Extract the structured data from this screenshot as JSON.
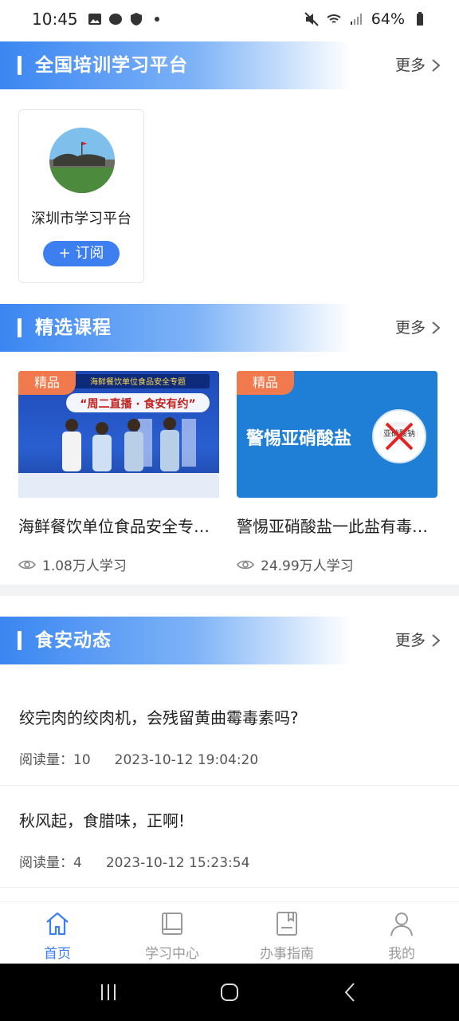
{
  "status": {
    "time": "10:45",
    "battery": "64%"
  },
  "platform_section": {
    "title": "全国培训学习平台",
    "more": "更多"
  },
  "platform_card": {
    "name": "深圳市学习平台",
    "subscribe": "+ 订阅"
  },
  "courses_section": {
    "title": "精选课程",
    "more": "更多"
  },
  "courses": [
    {
      "tag": "精品",
      "title": "海鲜餐饮单位食品安全专…",
      "learners": "1.08万人学习",
      "banner_top": "海鲜餐饮单位食品安全专题",
      "banner_main": "“周二直播 · 食安有约”"
    },
    {
      "tag": "精品",
      "title": "警惕亚硝酸盐一此盐有毒…",
      "learners": "24.99万人学习",
      "banner_main": "警惕亚硝酸盐",
      "banner_badge": "亚硝酸钠"
    }
  ],
  "news_section": {
    "title": "食安动态",
    "more": "更多"
  },
  "news": [
    {
      "title": "绞完肉的绞肉机，会残留黄曲霉毒素吗?",
      "reads_label": "阅读量：10",
      "time": "2023-10-12 19:04:20"
    },
    {
      "title": "秋风起，食腊味，正啊!",
      "reads_label": "阅读量：4",
      "time": "2023-10-12 15:23:54"
    }
  ],
  "nav": [
    {
      "label": "首页",
      "icon": "home-icon"
    },
    {
      "label": "学习中心",
      "icon": "book-icon"
    },
    {
      "label": "办事指南",
      "icon": "document-icon"
    },
    {
      "label": "我的",
      "icon": "user-icon"
    }
  ],
  "colors": {
    "accent": "#3d7ef0",
    "tag": "#f07a4e",
    "band_start": "#3a86f2"
  }
}
